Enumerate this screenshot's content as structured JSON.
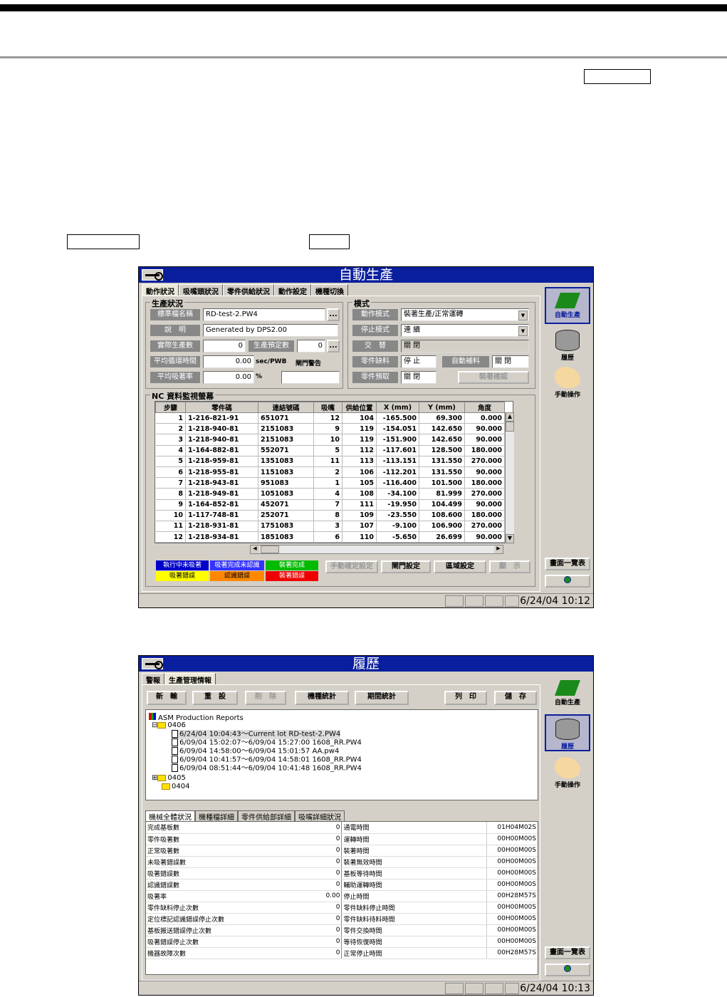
{
  "window1": {
    "title": "自動生產",
    "tabs": [
      "動作狀況",
      "吸嘴頭狀況",
      "零件供給狀況",
      "動作設定",
      "機種切換"
    ],
    "production_group": {
      "label": "生產狀況",
      "board_name_label": "標準檔名稱",
      "board_name": "RD-test-2.PW4",
      "desc_label": "說　明",
      "desc": "Generated by DPS2.00",
      "actual_count_label": "實際生產數",
      "actual_count": "0",
      "planned_count_label": "生產預定數",
      "planned_count": "0",
      "avg_cycle_label": "平均循環時間",
      "avg_cycle": "0.00",
      "avg_cycle_unit": "sec/PWB",
      "gate_warn": "閘門警告",
      "avg_pickup_label": "平均吸著率",
      "avg_pickup": "0.00",
      "avg_pickup_unit": "%",
      "browse": "..."
    },
    "mode_group": {
      "label": "模式",
      "op_mode_label": "動作模式",
      "op_mode": "裝著生產/正常運轉",
      "stop_mode_label": "停止模式",
      "stop_mode": "連 續",
      "alt_label": "交　替",
      "alt": "關 閉",
      "part_short_label": "零件缺料",
      "part_short": "停 止",
      "auto_feed_label": "自動補料",
      "auto_feed": "關 閉",
      "part_presort_label": "零件預取",
      "part_presort": "關 閉",
      "confirm_btn": "裝著確認"
    },
    "nc_group": {
      "label": "NC 資料監視螢幕",
      "columns": [
        "步驟",
        "零件碼",
        "連結號碼",
        "吸嘴",
        "供給位置",
        "X (mm)",
        "Y (mm)",
        "角度"
      ],
      "rows": [
        [
          "1",
          "1-216-821-91",
          "651071",
          "12",
          "104",
          "-165.500",
          "69.300",
          "0.000"
        ],
        [
          "2",
          "1-218-940-81",
          "2151083",
          "9",
          "119",
          "-154.051",
          "142.650",
          "90.000"
        ],
        [
          "3",
          "1-218-940-81",
          "2151083",
          "10",
          "119",
          "-151.900",
          "142.650",
          "90.000"
        ],
        [
          "4",
          "1-164-882-81",
          "552071",
          "5",
          "112",
          "-117.601",
          "128.500",
          "180.000"
        ],
        [
          "5",
          "1-218-959-81",
          "1351083",
          "11",
          "113",
          "-113.151",
          "131.550",
          "270.000"
        ],
        [
          "6",
          "1-218-955-81",
          "1151083",
          "2",
          "106",
          "-112.201",
          "131.550",
          "90.000"
        ],
        [
          "7",
          "1-218-943-81",
          "951083",
          "1",
          "105",
          "-116.400",
          "101.500",
          "180.000"
        ],
        [
          "8",
          "1-218-949-81",
          "1051083",
          "4",
          "108",
          "-34.100",
          "81.999",
          "270.000"
        ],
        [
          "9",
          "1-164-852-81",
          "452071",
          "7",
          "111",
          "-19.950",
          "104.499",
          "90.000"
        ],
        [
          "10",
          "1-117-748-81",
          "252071",
          "8",
          "109",
          "-23.550",
          "108.600",
          "180.000"
        ],
        [
          "11",
          "1-218-931-81",
          "1751083",
          "3",
          "107",
          "-9.100",
          "106.900",
          "270.000"
        ],
        [
          "12",
          "1-218-934-81",
          "1851083",
          "6",
          "110",
          "-5.650",
          "26.699",
          "90.000"
        ]
      ]
    },
    "legend": {
      "items": [
        "執行中未吸著",
        "吸著完成未認識",
        "裝著完成",
        "吸著錯誤",
        "認識錯誤",
        "裝著錯誤"
      ],
      "colors": [
        "#0000cc",
        "#3333ff",
        "#00bb00",
        "#ffff00",
        "#ff8800",
        "#ee0000"
      ]
    },
    "buttons": [
      "手動確定設定",
      "閘門設定",
      "區域設定",
      "顯　示"
    ],
    "sidebar": [
      "自動生產",
      "履歷",
      "手動操作",
      "畫面一覽表"
    ],
    "datetime": "6/24/04 10:12"
  },
  "window2": {
    "title": "履歷",
    "tabs": [
      "警報",
      "生產管理情報"
    ],
    "toolbar": [
      "新　輸",
      "重　設",
      "削　除",
      "機種統計",
      "期間統計",
      "列　印",
      "儲　存"
    ],
    "tree": {
      "root": "ASM Production Reports",
      "f0406": "0406",
      "entries": [
        "6/24/04 10:04:43～Current lot  RD-test-2.PW4",
        "6/09/04 15:02:07～6/09/04 15:27:00  1608_RR.PW4",
        "6/09/04 14:58:00～6/09/04 15:01:57  AA.pw4",
        "6/09/04 10:41:57～6/09/04 14:58:01  1608_RR.PW4",
        "6/09/04 08:51:44～6/09/04 10:41:48  1608_RR.PW4"
      ],
      "f0405": "0405",
      "f0404": "0404"
    },
    "subtabs": [
      "機械全體狀況",
      "機種檔詳細",
      "零件供給部詳細",
      "吸嘴詳細狀況"
    ],
    "stats": [
      [
        "完成基板數",
        "0",
        "通電時間",
        "01H04M02S"
      ],
      [
        "零件吸著數",
        "0",
        "運轉時間",
        "00H00M00S"
      ],
      [
        "正常吸著數",
        "0",
        "裝著時間",
        "00H00M00S"
      ],
      [
        "未吸著錯誤數",
        "0",
        "裝著無效時間",
        "00H00M00S"
      ],
      [
        "吸著錯誤數",
        "0",
        "基板等待時間",
        "00H00M00S"
      ],
      [
        "認識錯誤數",
        "0",
        "輔助運轉時間",
        "00H00M00S"
      ],
      [
        "吸著率",
        "0.00",
        "停止時間",
        "00H28M57S"
      ],
      [
        "零件缺料停止次數",
        "0",
        "零件缺料停止時間",
        "00H00M00S"
      ],
      [
        "定位標記認識錯誤停止次數",
        "0",
        "零件缺料待料時間",
        "00H00M00S"
      ],
      [
        "基板搬送錯誤停止次數",
        "0",
        "零件交換時間",
        "00H00M00S"
      ],
      [
        "吸著錯誤停止次數",
        "0",
        "等待恢復時間",
        "00H00M00S"
      ],
      [
        "機器故障次數",
        "0",
        "正常停止時間",
        "00H28M57S"
      ]
    ],
    "sidebar": [
      "自動生產",
      "履歷",
      "手動操作",
      "畫面一覽表"
    ],
    "datetime": "6/24/04 10:13"
  }
}
